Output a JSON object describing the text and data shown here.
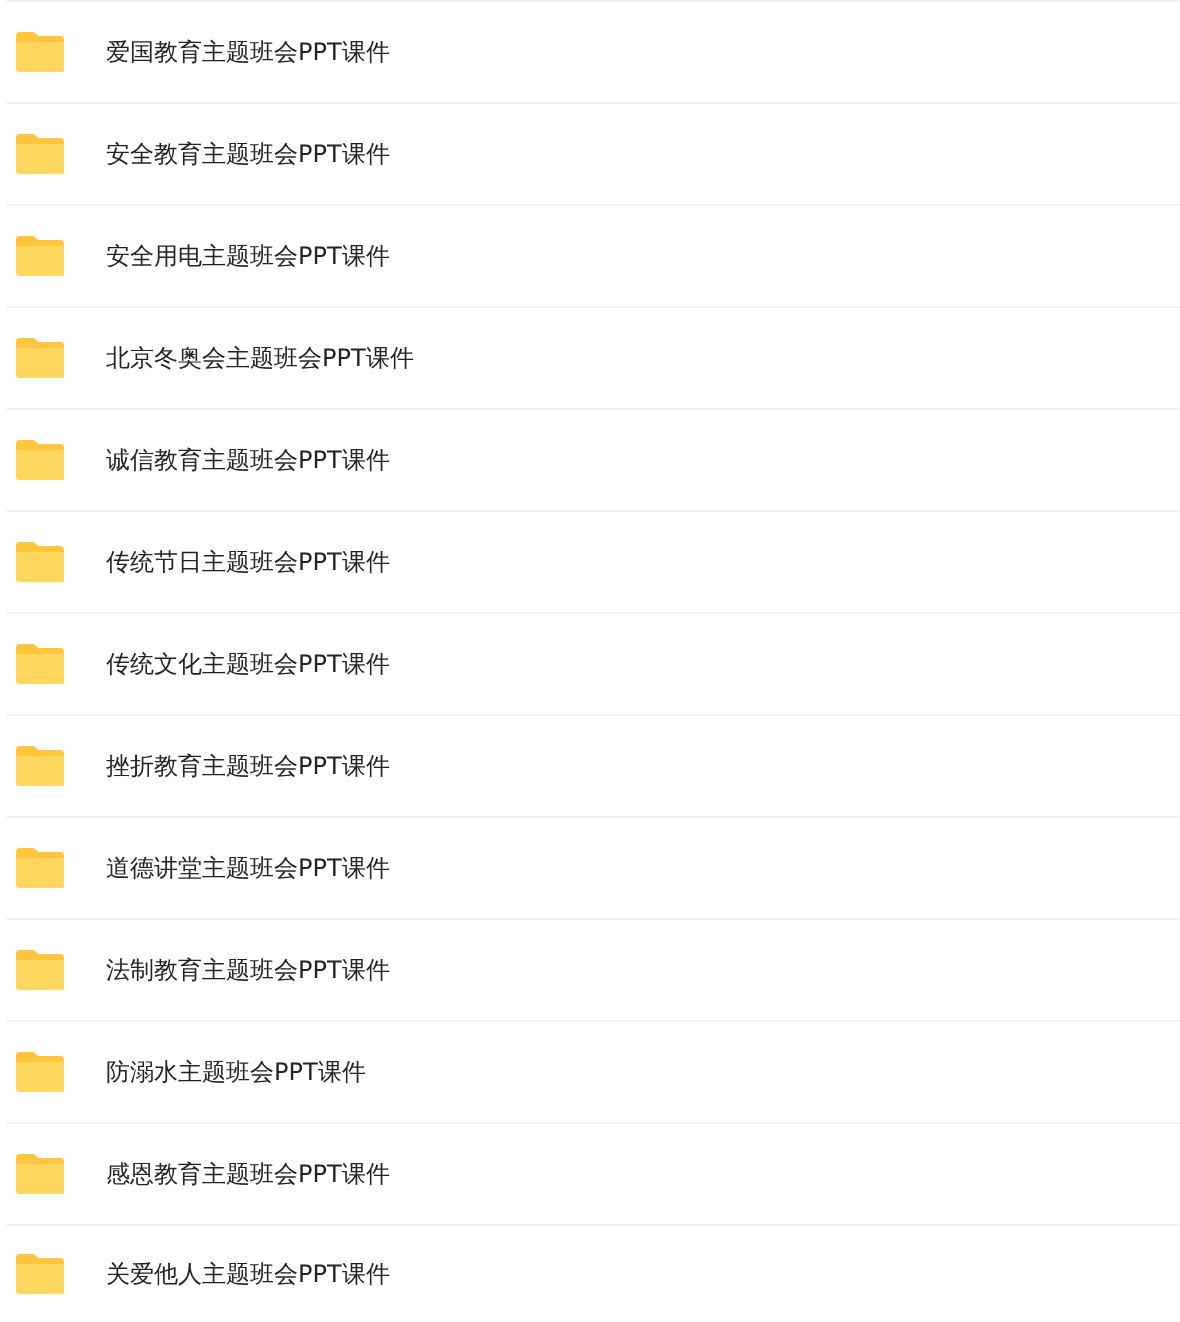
{
  "folders": [
    {
      "name": "爱国教育主题班会PPT课件"
    },
    {
      "name": "安全教育主题班会PPT课件"
    },
    {
      "name": "安全用电主题班会PPT课件"
    },
    {
      "name": "北京冬奥会主题班会PPT课件"
    },
    {
      "name": "诚信教育主题班会PPT课件"
    },
    {
      "name": "传统节日主题班会PPT课件"
    },
    {
      "name": "传统文化主题班会PPT课件"
    },
    {
      "name": "挫折教育主题班会PPT课件"
    },
    {
      "name": "道德讲堂主题班会PPT课件"
    },
    {
      "name": "法制教育主题班会PPT课件"
    },
    {
      "name": "防溺水主题班会PPT课件"
    },
    {
      "name": "感恩教育主题班会PPT课件"
    },
    {
      "name": "关爱他人主题班会PPT课件"
    }
  ]
}
